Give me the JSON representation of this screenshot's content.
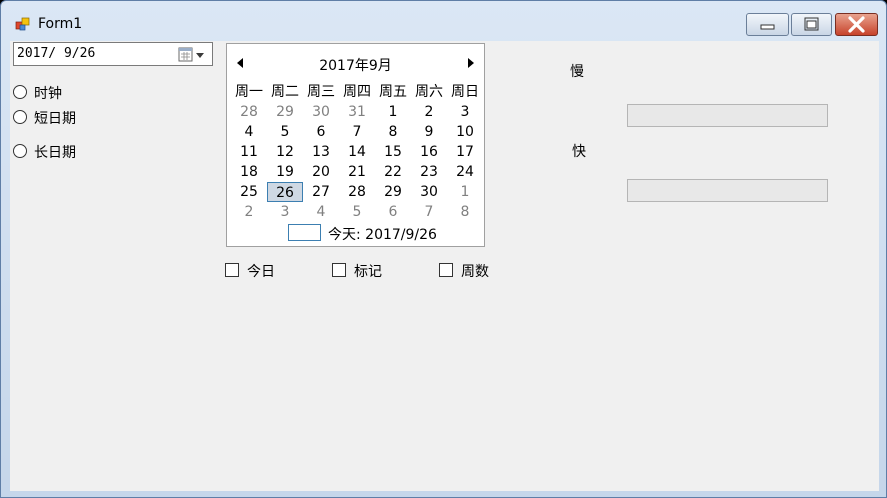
{
  "window": {
    "title": "Form1"
  },
  "date_picker": {
    "value": "2017/ 9/26"
  },
  "radios": [
    {
      "label": "时钟"
    },
    {
      "label": "短日期"
    },
    {
      "label": "长日期"
    }
  ],
  "calendar": {
    "title": "2017年9月",
    "weekdays": [
      "周一",
      "周二",
      "周三",
      "周四",
      "周五",
      "周六",
      "周日"
    ],
    "weeks": [
      [
        "28",
        "29",
        "30",
        "31",
        "1",
        "2",
        "3"
      ],
      [
        "4",
        "5",
        "6",
        "7",
        "8",
        "9",
        "10"
      ],
      [
        "11",
        "12",
        "13",
        "14",
        "15",
        "16",
        "17"
      ],
      [
        "18",
        "19",
        "20",
        "21",
        "22",
        "23",
        "24"
      ],
      [
        "25",
        "26",
        "27",
        "28",
        "29",
        "30",
        "1"
      ],
      [
        "2",
        "3",
        "4",
        "5",
        "6",
        "7",
        "8"
      ]
    ],
    "selected": "26",
    "today_label": "今天: 2017/9/26"
  },
  "checkboxes": [
    {
      "label": "今日"
    },
    {
      "label": "标记"
    },
    {
      "label": "周数"
    }
  ],
  "speed": {
    "slow_label": "慢",
    "fast_label": "快",
    "slow_value": "",
    "fast_value": ""
  },
  "colors": {
    "selection_border": "#3c7fb1",
    "selection_fill": "#cfd8e3",
    "close_red": "#c7432b"
  }
}
